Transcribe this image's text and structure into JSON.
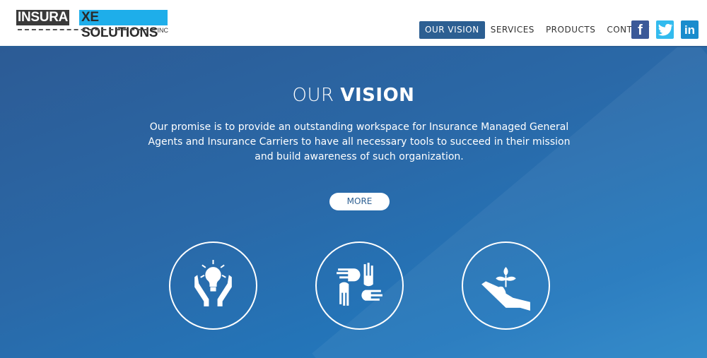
{
  "logo": {
    "part1": "INSURA",
    "part2": "XE SOLUTIONS",
    "suffix": "INC"
  },
  "nav": [
    {
      "label": "OUR VISION",
      "active": true
    },
    {
      "label": "SERVICES"
    },
    {
      "label": "PRODUCTS"
    },
    {
      "label": "CONTACT"
    }
  ],
  "social": [
    {
      "icon": "facebook-icon",
      "glyph": "f",
      "color": "#3b5998"
    },
    {
      "icon": "twitter-icon",
      "glyph": "t",
      "color": "#33bbee"
    },
    {
      "icon": "linkedin-icon",
      "glyph": "in",
      "color": "#1a8ccd"
    }
  ],
  "hero": {
    "title_light": "OUR",
    "title_bold": "VISION",
    "description": "Our promise is to provide an outstanding workspace for Insurance Managed General Agents and Insurance Carriers to have all necessary tools to succeed in their mission and build awareness of such organization.",
    "more_label": "MORE"
  },
  "features": [
    {
      "icon": "lightbulb-hands-icon"
    },
    {
      "icon": "four-hands-icon"
    },
    {
      "icon": "plant-hand-icon"
    }
  ]
}
